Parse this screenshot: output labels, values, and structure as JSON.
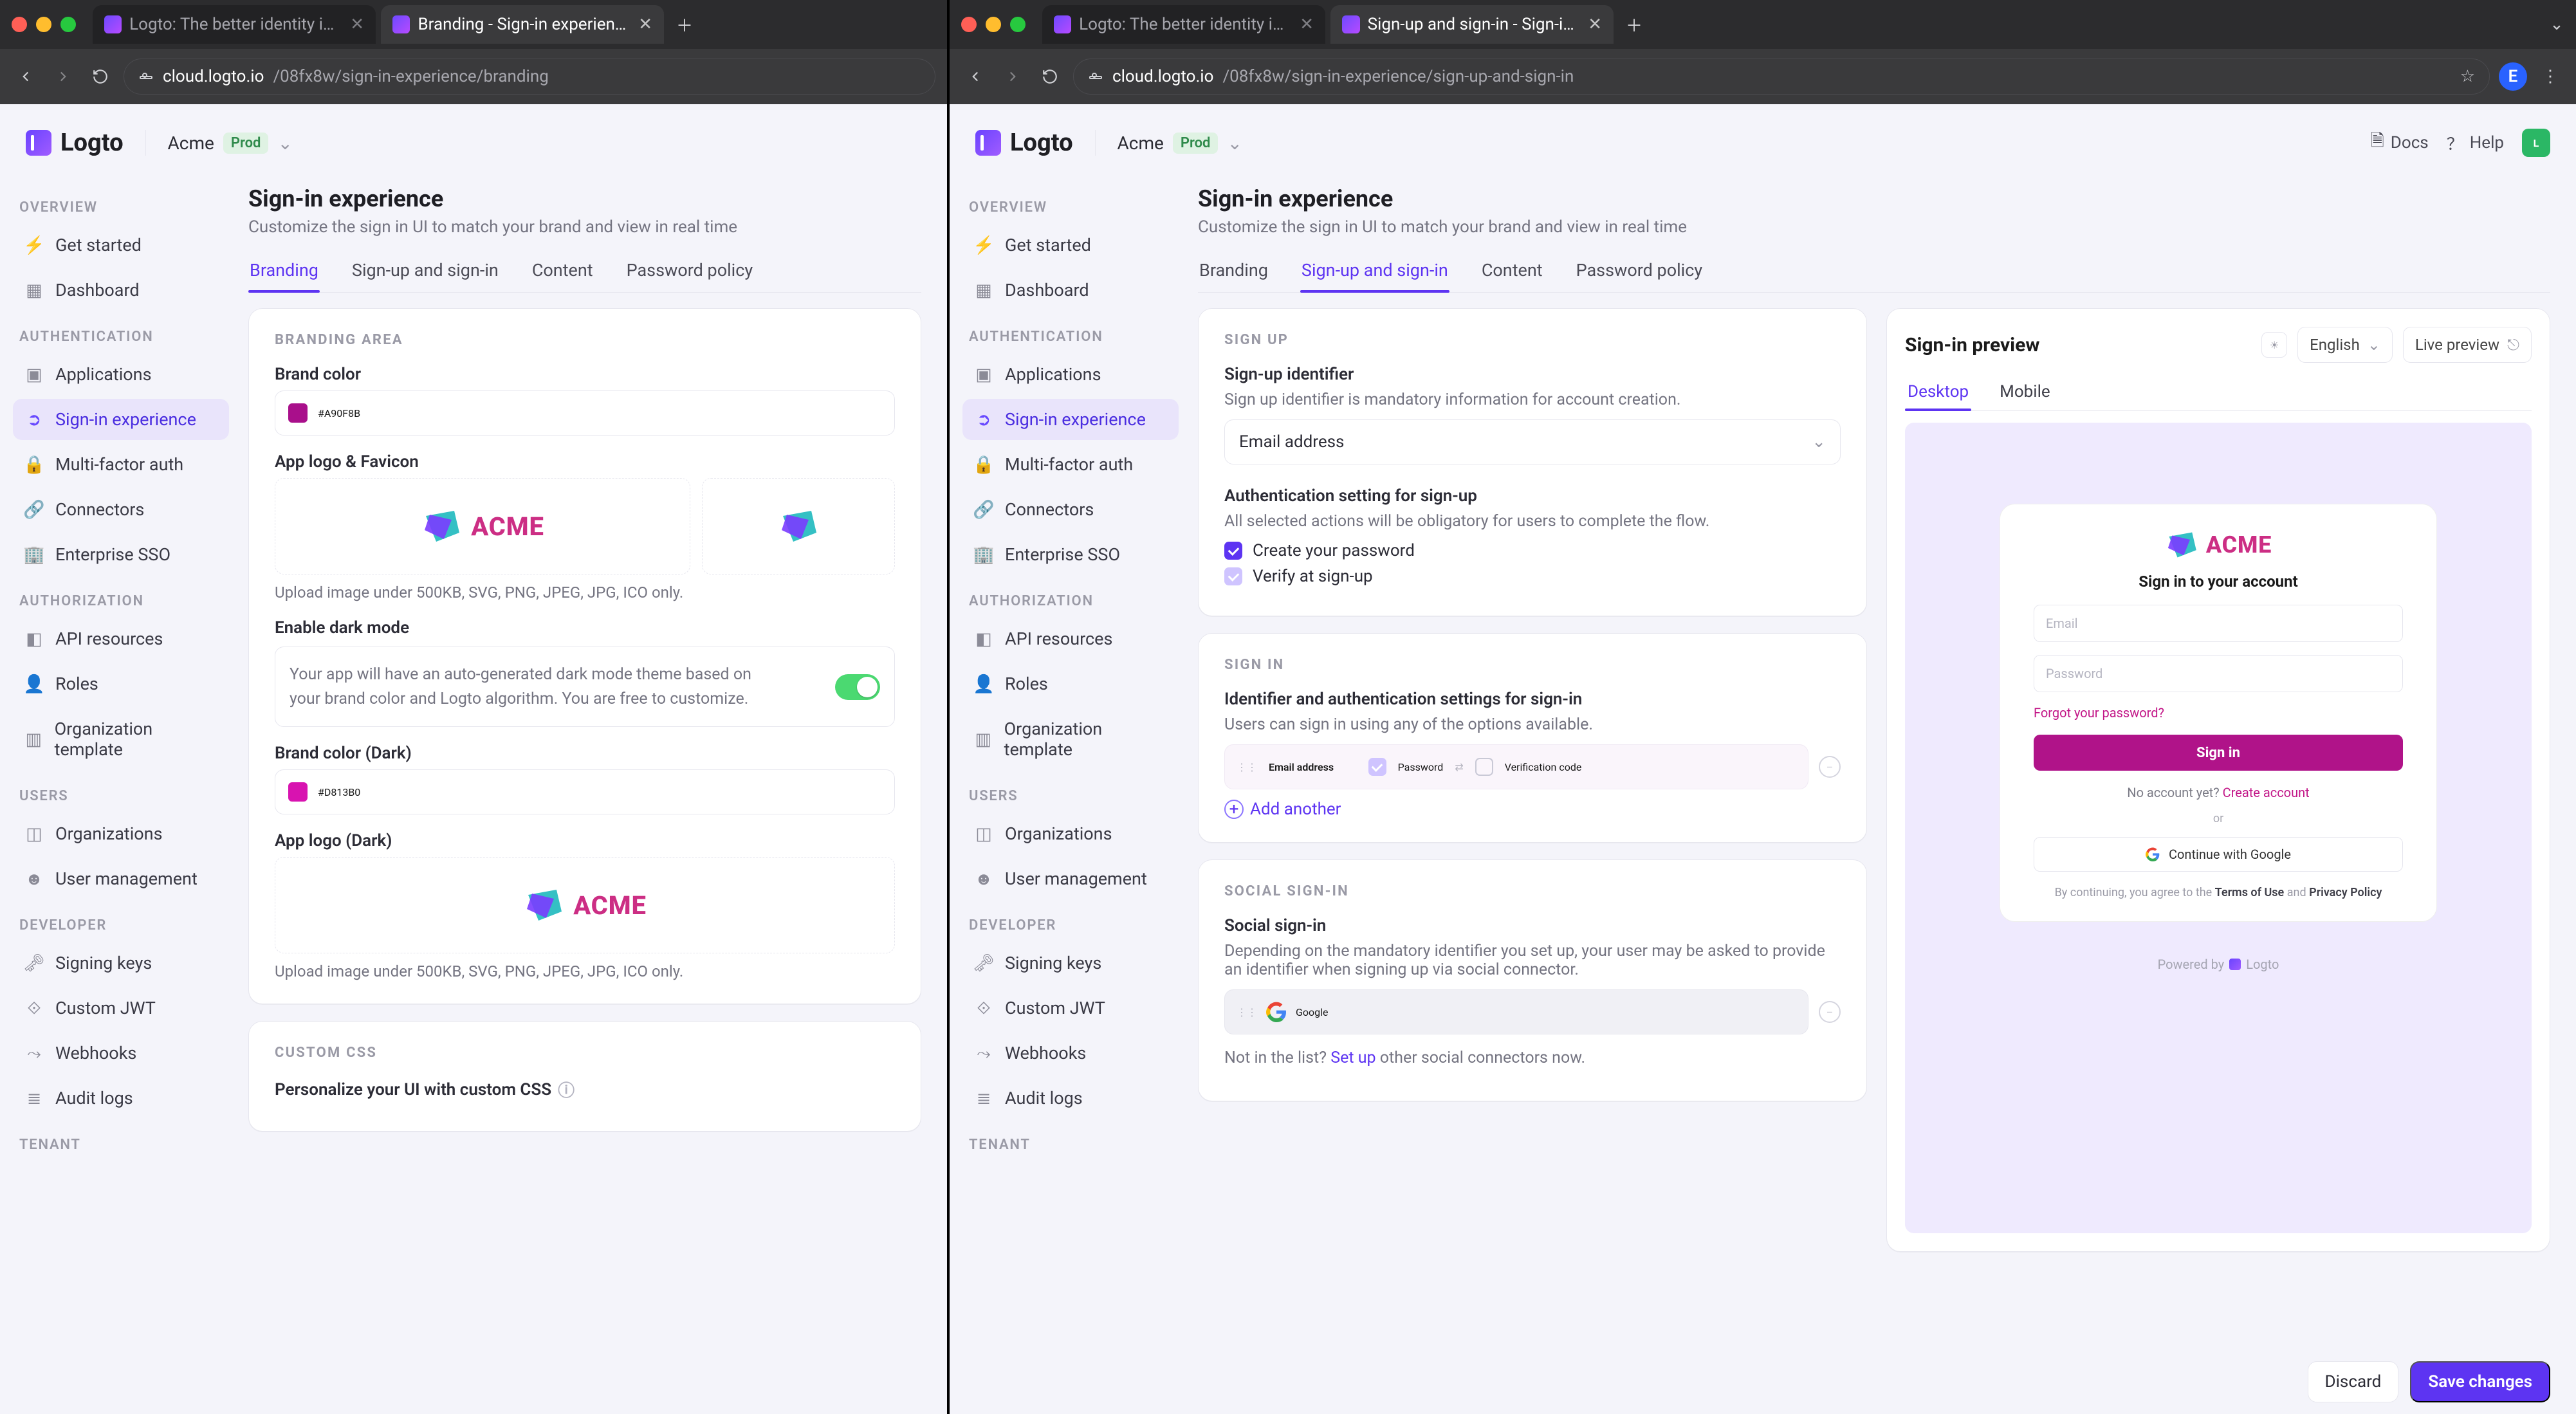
{
  "chrome": {
    "left": {
      "tabs": [
        {
          "title": "Logto: The better identity inf…",
          "active": false
        },
        {
          "title": "Branding - Sign-in experienc…",
          "active": true
        }
      ],
      "url_domain": "cloud.logto.io",
      "url_path": "/08fx8w/sign-in-experience/branding"
    },
    "right": {
      "tabs": [
        {
          "title": "Logto: The better identity inf…",
          "active": false
        },
        {
          "title": "Sign-up and sign-in - Sign-in…",
          "active": true
        }
      ],
      "url_domain": "cloud.logto.io",
      "url_path": "/08fx8w/sign-in-experience/sign-up-and-sign-in"
    }
  },
  "app": {
    "brand": "Logto",
    "tenant": "Acme",
    "env": "Prod",
    "docs": "Docs",
    "help": "Help",
    "avatar_letter": "L"
  },
  "sidebar": {
    "sections": {
      "overview": "OVERVIEW",
      "authn": "AUTHENTICATION",
      "authz": "AUTHORIZATION",
      "users": "USERS",
      "dev": "DEVELOPER",
      "tenant": "TENANT"
    },
    "items": {
      "get_started": "Get started",
      "dashboard": "Dashboard",
      "applications": "Applications",
      "sie": "Sign-in experience",
      "mfa": "Multi-factor auth",
      "connectors": "Connectors",
      "esso": "Enterprise SSO",
      "api": "API resources",
      "roles": "Roles",
      "org_tpl": "Organization template",
      "orgs": "Organizations",
      "user_mgmt": "User management",
      "signing": "Signing keys",
      "jwt": "Custom JWT",
      "webhooks": "Webhooks",
      "audit": "Audit logs"
    }
  },
  "page": {
    "title": "Sign-in experience",
    "subtitle": "Customize the sign in UI to match your brand and view in real time",
    "tabs": {
      "branding": "Branding",
      "signup": "Sign-up and sign-in",
      "content": "Content",
      "password": "Password policy"
    }
  },
  "branding": {
    "section": "BRANDING AREA",
    "brand_color_label": "Brand color",
    "brand_color_value": "#A90F8B",
    "logo_label": "App logo & Favicon",
    "upload_hint": "Upload image under 500KB, SVG, PNG, JPEG, JPG, ICO only.",
    "dark_label": "Enable dark mode",
    "dark_note": "Your app will have an auto-generated dark mode theme based on your brand color and Logto algorithm. You are free to customize.",
    "brand_color_dark_label": "Brand color (Dark)",
    "brand_color_dark_value": "#D813B0",
    "logo_dark_label": "App logo (Dark)",
    "custom_css_section": "CUSTOM CSS",
    "custom_css_label": "Personalize your UI with custom CSS"
  },
  "signup": {
    "sign_up_section": "SIGN UP",
    "identifier_label": "Sign-up identifier",
    "identifier_desc": "Sign up identifier is mandatory information for account creation.",
    "identifier_value": "Email address",
    "auth_label": "Authentication setting for sign-up",
    "auth_desc": "All selected actions will be obligatory for users to complete the flow.",
    "check_password": "Create your password",
    "check_verify": "Verify at sign-up",
    "sign_in_section": "SIGN IN",
    "sign_in_label": "Identifier and authentication settings for sign-in",
    "sign_in_desc": "Users can sign in using any of the options available.",
    "chip_email": "Email address",
    "chip_password": "Password",
    "chip_code": "Verification code",
    "add_another": "Add another",
    "social_section": "SOCIAL SIGN-IN",
    "social_label": "Social sign-in",
    "social_desc": "Depending on the mandatory identifier you set up, your user may be asked to provide an identifier when signing up via social connector.",
    "social_google": "Google",
    "not_in_list_prefix": "Not in the list? ",
    "not_in_list_link": "Set up",
    "not_in_list_suffix": " other social connectors now."
  },
  "preview": {
    "title": "Sign-in preview",
    "lang": "English",
    "live": "Live preview",
    "tabs": {
      "desktop": "Desktop",
      "mobile": "Mobile"
    },
    "signin_title": "Sign in to your account",
    "email_ph": "Email",
    "password_ph": "Password",
    "forgot": "Forgot your password?",
    "signin_btn": "Sign in",
    "no_account_prefix": "No account yet? ",
    "no_account_link": "Create account",
    "or": "or",
    "google_btn": "Continue with Google",
    "legal_prefix": "By continuing, you agree to the ",
    "legal_terms": "Terms of Use",
    "legal_and": " and ",
    "legal_privacy": "Privacy Policy",
    "powered_prefix": "Powered by ",
    "powered_brand": "Logto"
  },
  "savebar": {
    "discard": "Discard",
    "save": "Save changes"
  },
  "brand_word": "ACME"
}
